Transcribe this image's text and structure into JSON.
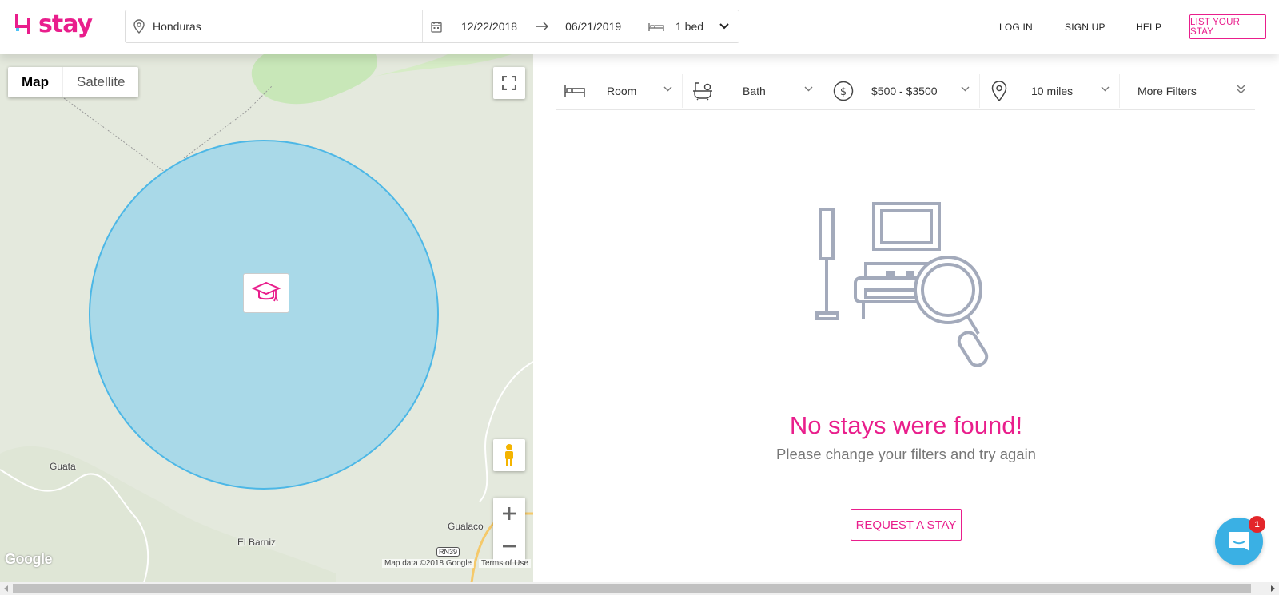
{
  "brand": {
    "name": "stay",
    "accent": "#e91e8c"
  },
  "search": {
    "location": "Honduras",
    "check_in": "12/22/2018",
    "check_out": "06/21/2019",
    "beds": "1 bed"
  },
  "nav": {
    "login": "LOG IN",
    "signup": "SIGN UP",
    "help": "HELP",
    "list_stay": "LIST YOUR STAY"
  },
  "map": {
    "toggle": {
      "map": "Map",
      "satellite": "Satellite"
    },
    "labels": {
      "guata": "Guata",
      "el_barniz": "El Barniz",
      "gualaco": "Gualaco"
    },
    "route": "RN39",
    "attribution": "Map data ©2018 Google",
    "terms": "Terms of Use",
    "google": "Google",
    "radius_color": "#9fd6ea"
  },
  "filters": {
    "room": "Room",
    "bath": "Bath",
    "price": "$500 - $3500",
    "distance": "10 miles",
    "more": "More Filters"
  },
  "empty": {
    "title": "No stays were found!",
    "subtitle": "Please change your filters and try again",
    "request": "REQUEST A STAY"
  },
  "chat": {
    "badge": "1"
  }
}
